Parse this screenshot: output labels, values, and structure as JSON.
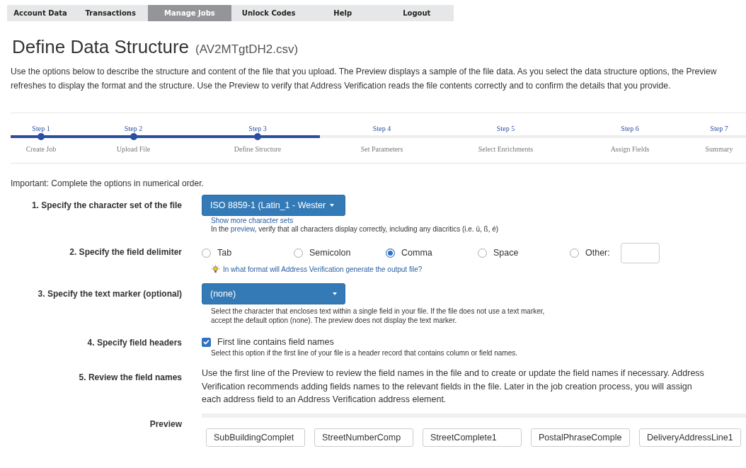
{
  "nav": [
    {
      "label": "Account Data",
      "selected": false
    },
    {
      "label": "Transactions",
      "selected": false
    },
    {
      "label": "Manage Jobs",
      "selected": true
    },
    {
      "label": "Unlock Codes",
      "selected": false
    },
    {
      "label": "Help",
      "selected": false
    },
    {
      "label": "Logout",
      "selected": false
    }
  ],
  "title": "Define Data Structure",
  "file_name": "(AV2MTgtDH2.csv)",
  "intro": "Use the options below to describe the structure and content of the file that you upload. The Preview displays a sample of the file data. As you select the data structure options, the Preview refreshes to display the format and the structure. Use the Preview to verify that Address Verification reads the file contents correctly and to confirm the details that you provide.",
  "steps": [
    {
      "step": "Step 1",
      "name": "Create Job",
      "reached": true
    },
    {
      "step": "Step 2",
      "name": "Upload File",
      "reached": true
    },
    {
      "step": "Step 3",
      "name": "Define Structure",
      "reached": true
    },
    {
      "step": "Step 4",
      "name": "Set Parameters",
      "reached": false
    },
    {
      "step": "Step 5",
      "name": "Select Enrichments",
      "reached": false
    },
    {
      "step": "Step 6",
      "name": "Assign Fields",
      "reached": false
    },
    {
      "step": "Step 7",
      "name": "Summary",
      "reached": false
    }
  ],
  "important": "Important: Complete the options in numerical order.",
  "charset": {
    "label": "1. Specify the character set of the file",
    "value": "ISO 8859-1 (Latin_1 - Wester",
    "link": "Show more character sets",
    "hint_before": "In the ",
    "hint_link": "preview",
    "hint_after": ", verify that all characters display correctly, including any diacritics (i.e. ü, ß, é)"
  },
  "delimiter": {
    "label": "2. Specify the field delimiter",
    "options": [
      {
        "label": "Tab",
        "selected": false
      },
      {
        "label": "Semicolon",
        "selected": false
      },
      {
        "label": "Comma",
        "selected": true
      },
      {
        "label": "Space",
        "selected": false
      },
      {
        "label": "Other:",
        "selected": false
      }
    ],
    "help_link": "In what format will Address Verification generate the output file?"
  },
  "text_marker": {
    "label": "3. Specify the text marker (optional)",
    "value": "(none)",
    "hint": "Select the character that encloses text within a single field in your file. If the file does not use a text marker, accept the default option (none). The preview does not display the text marker."
  },
  "headers": {
    "label": "4. Specify field headers",
    "checkbox": "First line contains field names",
    "checked": true,
    "hint": "Select this option if the first line of your file is a header record that contains column or field names."
  },
  "review": {
    "label": "5. Review the field names",
    "text": "Use the first line of the Preview to review the field names in the file and to create or update the field names if necessary. Address Verification recommends adding fields names to the relevant fields in the file. Later in the job creation process, you will assign each address field to an Address Verification address element."
  },
  "preview": {
    "label": "Preview",
    "fields": [
      "SubBuildingComplet",
      "StreetNumberComp",
      "StreetComplete1",
      "PostalPhraseComple",
      "DeliveryAddressLine1"
    ]
  }
}
